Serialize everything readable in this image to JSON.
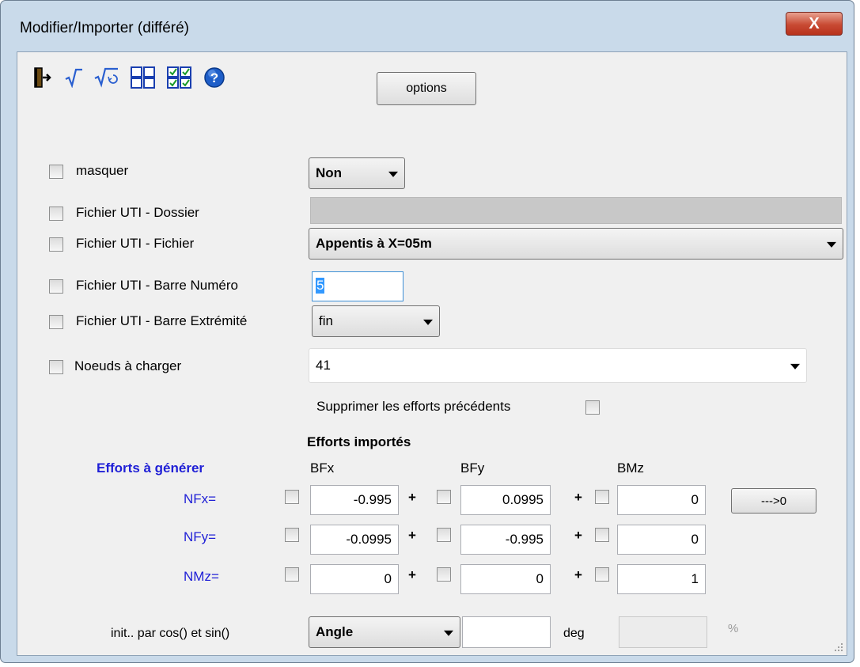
{
  "window": {
    "title": "Modifier/Importer (différé)",
    "close_glyph": "X"
  },
  "toolbar": {
    "icons": [
      "exit-door-icon",
      "sqrt-icon",
      "sqrt-refresh-icon",
      "grid-empty-icon",
      "grid-checked-icon",
      "help-icon"
    ],
    "options_label": "options"
  },
  "rows": {
    "masquer": {
      "label": "masquer",
      "value": "Non"
    },
    "dossier": {
      "label": "Fichier UTI - Dossier",
      "value": ""
    },
    "fichier": {
      "label": "Fichier UTI - Fichier",
      "value": "Appentis à X=05m"
    },
    "barre_numero": {
      "label": "Fichier UTI - Barre Numéro",
      "value": "5"
    },
    "barre_extremite": {
      "label": "Fichier UTI - Barre Extrémité",
      "value": "fin"
    },
    "noeuds": {
      "label": "Noeuds à charger",
      "value": "41"
    }
  },
  "supprimer_label": "Supprimer les efforts précédents",
  "efforts": {
    "imported_title": "Efforts importés",
    "generate_title": "Efforts à générer",
    "columns": [
      "BFx",
      "BFy",
      "BMz"
    ],
    "row_labels": [
      "NFx=",
      "NFy=",
      "NMz="
    ],
    "plus": "+",
    "values": [
      [
        "-0.995",
        "0.0995",
        "0"
      ],
      [
        "-0.0995",
        "-0.995",
        "0"
      ],
      [
        "0",
        "0",
        "1"
      ]
    ],
    "zero_button": "--->0"
  },
  "init": {
    "label": "init.. par cos() et sin()",
    "mode": "Angle",
    "angle_value": "",
    "unit": "deg",
    "percent_value": "",
    "percent_unit": "%"
  },
  "colors": {
    "accent_blue": "#1f1fd6",
    "frame": "#c9daea",
    "client": "#f0f0f0"
  }
}
